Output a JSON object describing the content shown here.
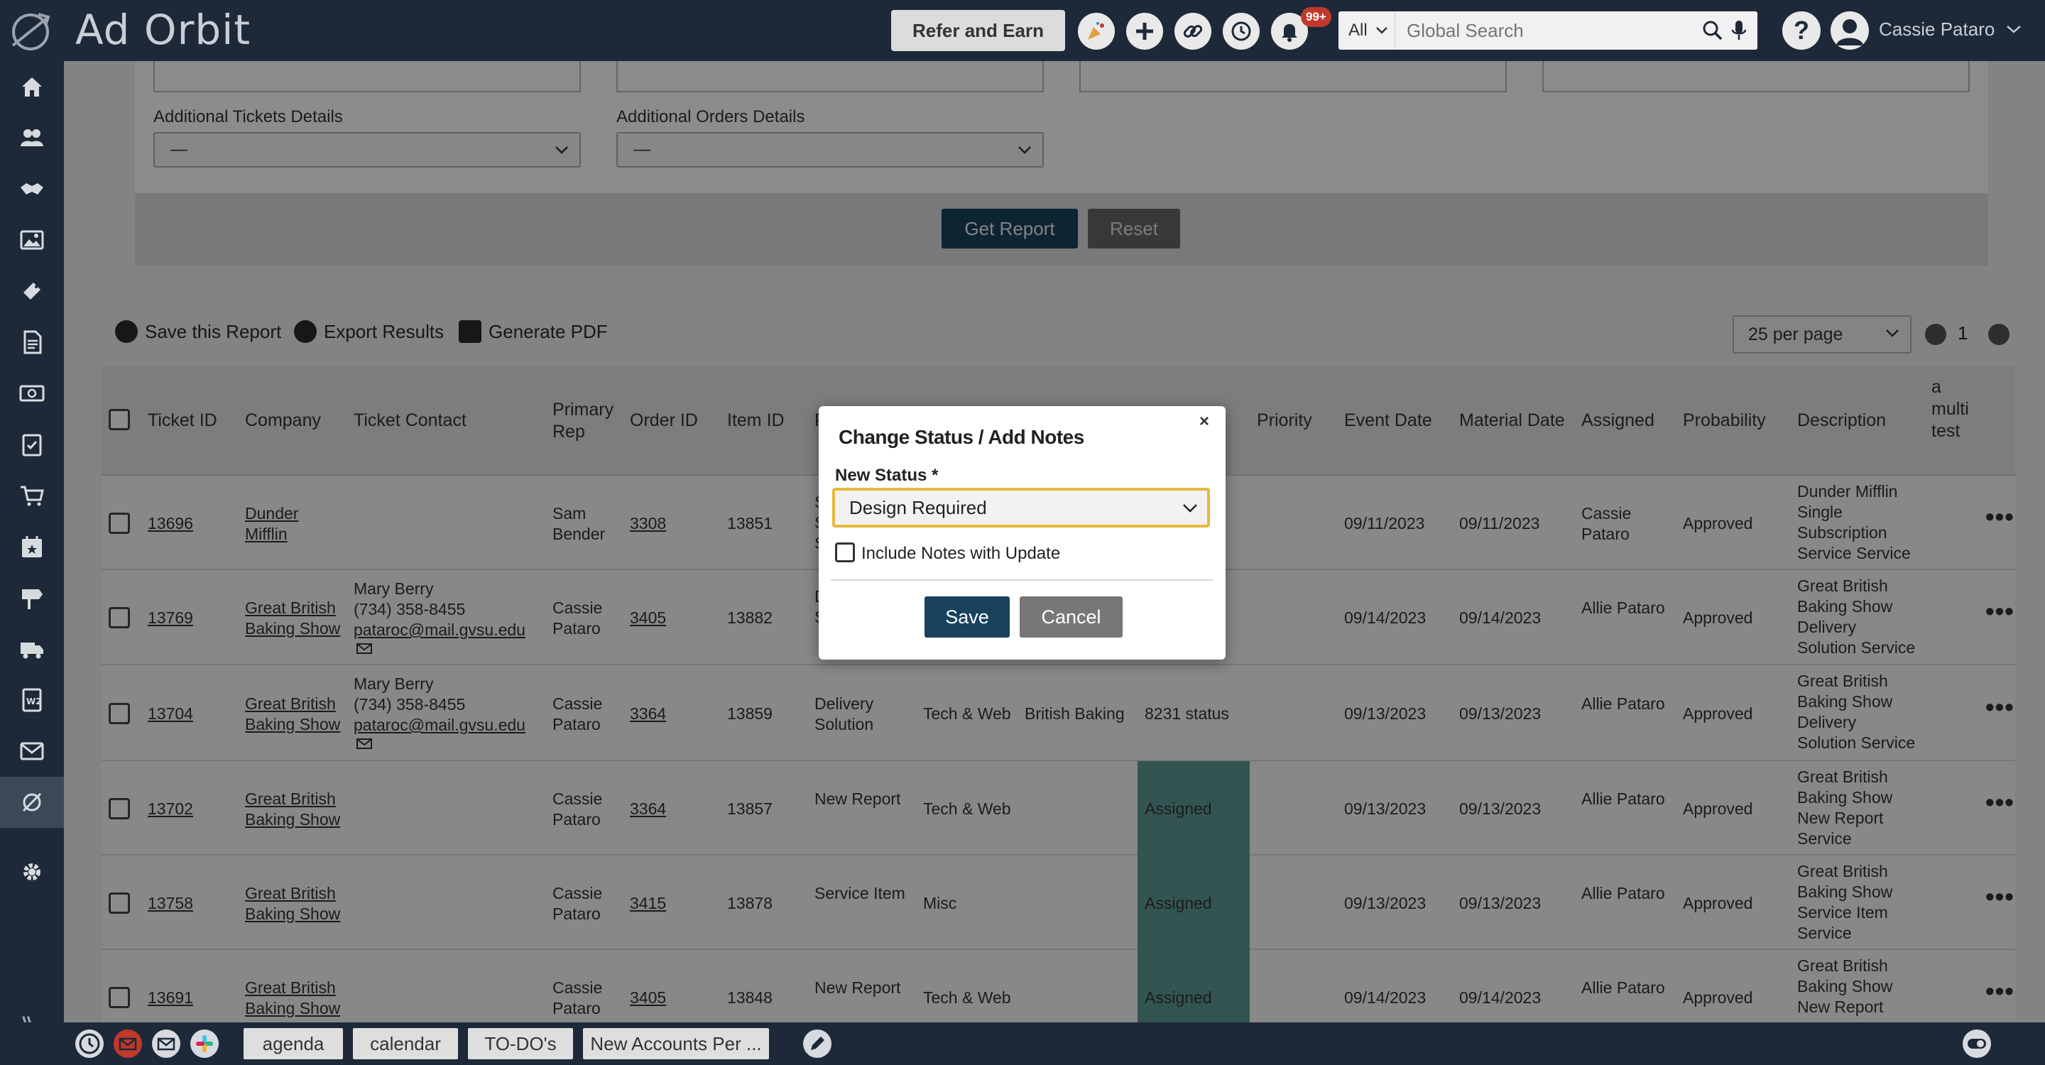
{
  "app": {
    "logo": "Ad Orbit",
    "user_name": "Cassie Pataro"
  },
  "topbar": {
    "refer_label": "Refer and Earn",
    "notification_count": "99+",
    "search_scope": "All",
    "search_placeholder": "Global Search"
  },
  "filters": {
    "additional_tickets_label": "Additional Tickets Details",
    "additional_tickets_value": "—",
    "additional_orders_label": "Additional Orders Details",
    "additional_orders_value": "—",
    "get_report_label": "Get Report",
    "reset_label": "Reset"
  },
  "results_toolbar": {
    "save_report": "Save this Report",
    "export_results": "Export Results",
    "generate_pdf": "Generate PDF",
    "per_page": "25 per page",
    "page": "1"
  },
  "table": {
    "headers": {
      "ticket_id": "Ticket ID",
      "company": "Company",
      "ticket_contact": "Ticket Contact",
      "primary_rep_1": "Primary",
      "primary_rep_2": "Rep",
      "order_id": "Order ID",
      "item_id": "Item ID",
      "partial_col": "P",
      "priority": "Priority",
      "event_date": "Event Date",
      "material_date": "Material Date",
      "assigned": "Assigned",
      "probability": "Probability",
      "description": "Description",
      "custom_1": "a",
      "custom_2": "multi",
      "custom_3": "test"
    },
    "rows": [
      {
        "ticket_id": "13696",
        "company_1": "Dunder",
        "company_2": "Mifflin",
        "contact_name": "",
        "contact_phone": "",
        "contact_email": "",
        "rep_1": "Sam",
        "rep_2": "Bender",
        "order_id": "3308",
        "item_id": "13851",
        "c1_1": "",
        "c1_2": "",
        "c2": "",
        "c3": "",
        "status": "",
        "event_date": "09/11/2023",
        "material_date": "09/11/2023",
        "assigned_1": "Cassie",
        "assigned_2": "Pataro",
        "probability": "Approved",
        "desc_1": "Dunder Mifflin",
        "desc_2": "Single",
        "desc_3": "Subscription",
        "desc_4": "Service Service",
        "partial_1": "S",
        "partial_2": "S",
        "partial_3": "S"
      },
      {
        "ticket_id": "13769",
        "company_1": "Great British",
        "company_2": "Baking Show",
        "contact_name": "Mary Berry",
        "contact_phone": "(734) 358-8455",
        "contact_email": "pataroc@mail.gvsu.edu",
        "rep_1": "Cassie",
        "rep_2": "Pataro",
        "order_id": "3405",
        "item_id": "13882",
        "c1_1": "",
        "c1_2": "",
        "c2": "",
        "c3": "",
        "status": "",
        "event_date": "09/14/2023",
        "material_date": "09/14/2023",
        "assigned_1": "Allie Pataro",
        "assigned_2": "",
        "probability": "Approved",
        "desc_1": "Great British",
        "desc_2": "Baking Show",
        "desc_3": "Delivery",
        "desc_4": "Solution Service",
        "partial_1": "D",
        "partial_2": "S",
        "partial_3": ""
      },
      {
        "ticket_id": "13704",
        "company_1": "Great British",
        "company_2": "Baking Show",
        "contact_name": "Mary Berry",
        "contact_phone": "(734) 358-8455",
        "contact_email": "pataroc@mail.gvsu.edu",
        "rep_1": "Cassie",
        "rep_2": "Pataro",
        "order_id": "3364",
        "item_id": "13859",
        "c1_1": "Delivery",
        "c1_2": "Solution",
        "c2": "Tech & Web",
        "c3": "British Baking",
        "status": "8231 status",
        "event_date": "09/13/2023",
        "material_date": "09/13/2023",
        "assigned_1": "Allie Pataro",
        "assigned_2": "",
        "probability": "Approved",
        "desc_1": "Great British",
        "desc_2": "Baking Show",
        "desc_3": "Delivery",
        "desc_4": "Solution Service",
        "partial_1": "",
        "partial_2": "",
        "partial_3": ""
      },
      {
        "ticket_id": "13702",
        "company_1": "Great British",
        "company_2": "Baking Show",
        "contact_name": "",
        "contact_phone": "",
        "contact_email": "",
        "rep_1": "Cassie",
        "rep_2": "Pataro",
        "order_id": "3364",
        "item_id": "13857",
        "c1_1": "New Report",
        "c1_2": "",
        "c2": "Tech & Web",
        "c3": "",
        "status": "Assigned",
        "event_date": "09/13/2023",
        "material_date": "09/13/2023",
        "assigned_1": "Allie Pataro",
        "assigned_2": "",
        "probability": "Approved",
        "desc_1": "Great British",
        "desc_2": "Baking Show",
        "desc_3": "New Report",
        "desc_4": "Service",
        "partial_1": "",
        "partial_2": "",
        "partial_3": ""
      },
      {
        "ticket_id": "13758",
        "company_1": "Great British",
        "company_2": "Baking Show",
        "contact_name": "",
        "contact_phone": "",
        "contact_email": "",
        "rep_1": "Cassie",
        "rep_2": "Pataro",
        "order_id": "3415",
        "item_id": "13878",
        "c1_1": "Service Item",
        "c1_2": "",
        "c2": "Misc",
        "c3": "",
        "status": "Assigned",
        "event_date": "09/13/2023",
        "material_date": "09/13/2023",
        "assigned_1": "Allie Pataro",
        "assigned_2": "",
        "probability": "Approved",
        "desc_1": "Great British",
        "desc_2": "Baking Show",
        "desc_3": "Service Item",
        "desc_4": "Service",
        "partial_1": "",
        "partial_2": "",
        "partial_3": ""
      },
      {
        "ticket_id": "13691",
        "company_1": "Great British",
        "company_2": "Baking Show",
        "contact_name": "",
        "contact_phone": "",
        "contact_email": "",
        "rep_1": "Cassie",
        "rep_2": "Pataro",
        "order_id": "3405",
        "item_id": "13848",
        "c1_1": "New Report",
        "c1_2": "",
        "c2": "Tech & Web",
        "c3": "",
        "status": "Assigned",
        "event_date": "09/14/2023",
        "material_date": "09/14/2023",
        "assigned_1": "Allie Pataro",
        "assigned_2": "",
        "probability": "Approved",
        "desc_1": "Great British",
        "desc_2": "Baking Show",
        "desc_3": "New Report",
        "desc_4": "",
        "partial_1": "",
        "partial_2": "",
        "partial_3": ""
      }
    ]
  },
  "modal": {
    "title": "Change Status / Add Notes",
    "close": "×",
    "status_label": "New Status *",
    "status_value": "Design Required",
    "include_notes_label": "Include Notes with Update",
    "save_label": "Save",
    "cancel_label": "Cancel"
  },
  "bottombar": {
    "tabs": [
      "agenda",
      "calendar",
      "TO-DO's",
      "New Accounts Per ..."
    ]
  },
  "colors": {
    "nav_bg": "#1d2938",
    "primary_button": "#18425e",
    "status_highlight": "#5b9c95",
    "focus_ring": "#e5b93c"
  }
}
